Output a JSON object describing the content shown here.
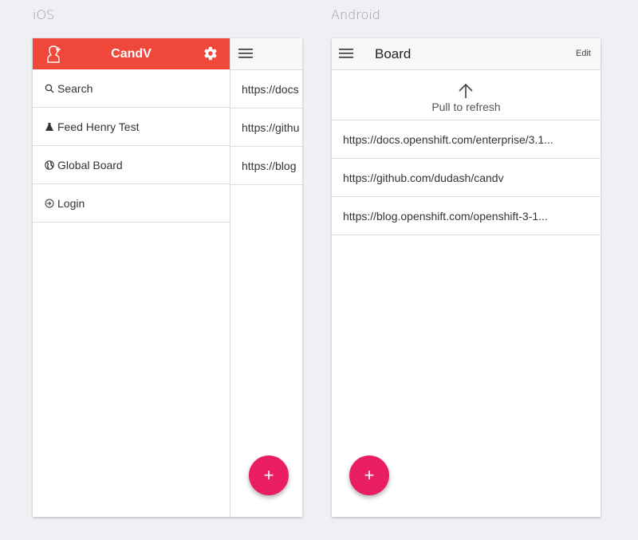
{
  "labels": {
    "ios": "iOS",
    "android": "Android"
  },
  "ios": {
    "title": "CandV",
    "menu": [
      {
        "label": "Search",
        "icon": "search-icon"
      },
      {
        "label": "Feed Henry Test",
        "icon": "flask-icon"
      },
      {
        "label": "Global Board",
        "icon": "globe-icon"
      },
      {
        "label": "Login",
        "icon": "login-icon"
      }
    ],
    "links": [
      "https://docs",
      "https://githu",
      "https://blog"
    ],
    "fab": "+"
  },
  "android": {
    "title": "Board",
    "edit": "Edit",
    "pull_to_refresh": "Pull to refresh",
    "links": [
      "https://docs.openshift.com/enterprise/3.1...",
      "https://github.com/dudash/candv",
      "https://blog.openshift.com/openshift-3-1..."
    ],
    "fab": "+"
  },
  "colors": {
    "header_red": "#ef473a",
    "fab_pink": "#e91e63",
    "background": "#eff0f4"
  }
}
